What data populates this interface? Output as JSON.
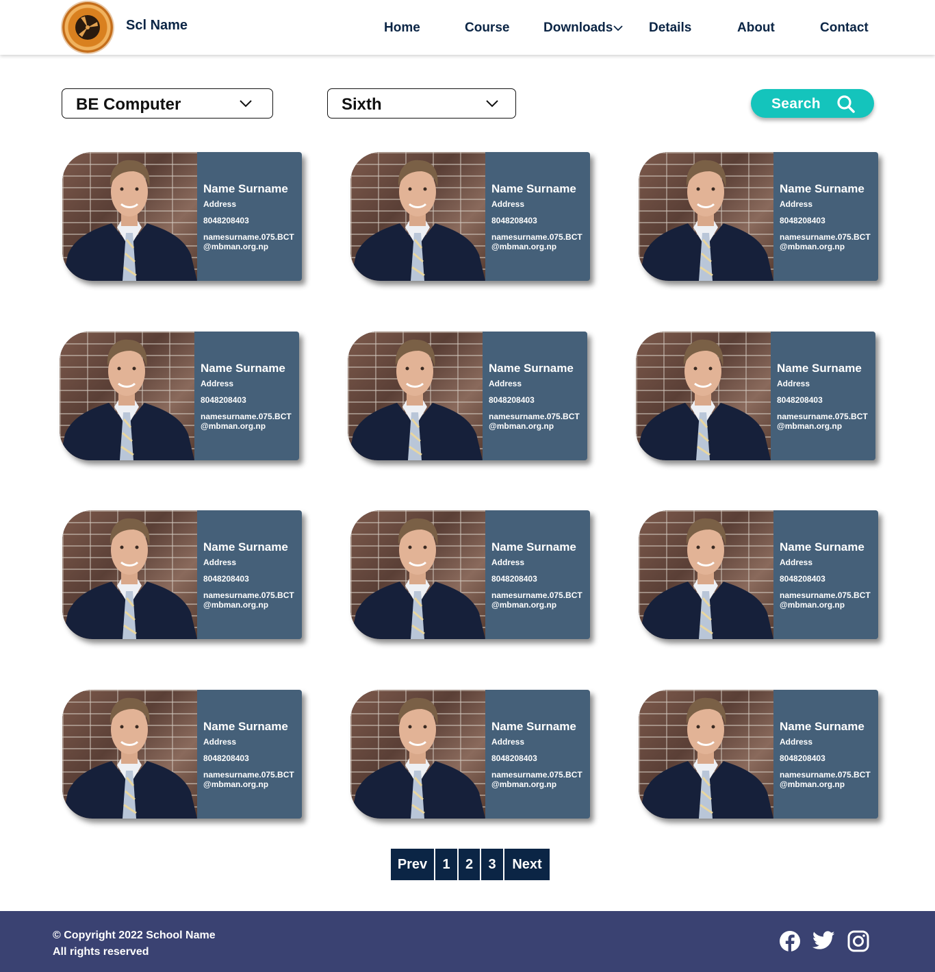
{
  "header": {
    "brand": "Scl Name",
    "nav": [
      {
        "label": "Home"
      },
      {
        "label": "Course"
      },
      {
        "label": "Downloads"
      },
      {
        "label": "Details"
      },
      {
        "label": "About"
      },
      {
        "label": "Contact"
      }
    ]
  },
  "filters": {
    "program": "BE Computer",
    "semester": "Sixth",
    "search_label": "Search"
  },
  "cards": [
    {
      "name": "Name Surname",
      "address": "Address",
      "phone": "8048208403",
      "email": "namesurname.075.BCT@mbman.org.np"
    },
    {
      "name": "Name Surname",
      "address": "Address",
      "phone": "8048208403",
      "email": "namesurname.075.BCT@mbman.org.np"
    },
    {
      "name": "Name Surname",
      "address": "Address",
      "phone": "8048208403",
      "email": "namesurname.075.BCT@mbman.org.np"
    },
    {
      "name": "Name Surname",
      "address": "Address",
      "phone": "8048208403",
      "email": "namesurname.075.BCT@mbman.org.np"
    },
    {
      "name": "Name Surname",
      "address": "Address",
      "phone": "8048208403",
      "email": "namesurname.075.BCT@mbman.org.np"
    },
    {
      "name": "Name Surname",
      "address": "Address",
      "phone": "8048208403",
      "email": "namesurname.075.BCT@mbman.org.np"
    },
    {
      "name": "Name Surname",
      "address": "Address",
      "phone": "8048208403",
      "email": "namesurname.075.BCT@mbman.org.np"
    },
    {
      "name": "Name Surname",
      "address": "Address",
      "phone": "8048208403",
      "email": "namesurname.075.BCT@mbman.org.np"
    },
    {
      "name": "Name Surname",
      "address": "Address",
      "phone": "8048208403",
      "email": "namesurname.075.BCT@mbman.org.np"
    },
    {
      "name": "Name Surname",
      "address": "Address",
      "phone": "8048208403",
      "email": "namesurname.075.BCT@mbman.org.np"
    },
    {
      "name": "Name Surname",
      "address": "Address",
      "phone": "8048208403",
      "email": "namesurname.075.BCT@mbman.org.np"
    },
    {
      "name": "Name Surname",
      "address": "Address",
      "phone": "8048208403",
      "email": "namesurname.075.BCT@mbman.org.np"
    }
  ],
  "pagination": {
    "prev": "Prev",
    "pages": [
      "1",
      "2",
      "3"
    ],
    "next": "Next"
  },
  "footer": {
    "copyright": "© Copyright 2022 School Name",
    "rights": "All rights reserved",
    "social_icons": [
      "facebook-icon",
      "twitter-icon",
      "instagram-icon"
    ]
  },
  "colors": {
    "primary": "#0b2545",
    "accent": "#14c4bc",
    "card": "#456079",
    "footer": "#3a4272"
  }
}
